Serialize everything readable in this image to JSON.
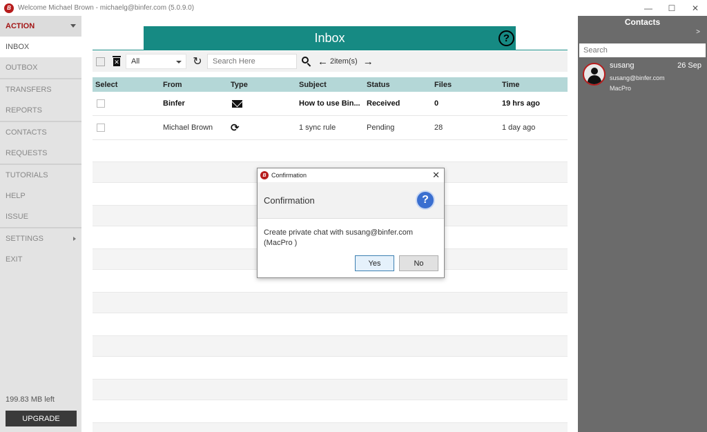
{
  "window": {
    "title": "Welcome  Michael Brown - michaelg@binfer.com (5.0.9.0)",
    "logo_text": "B",
    "controls": {
      "minimize": "—",
      "maximize": "☐",
      "close": "✕"
    }
  },
  "sidebar": {
    "action_label": "ACTION",
    "items": [
      {
        "label": "INBOX",
        "active": true
      },
      {
        "label": "OUTBOX"
      },
      {
        "label": "TRANSFERS"
      },
      {
        "label": "REPORTS"
      },
      {
        "label": "CONTACTS"
      },
      {
        "label": "REQUESTS"
      },
      {
        "label": "TUTORIALS"
      },
      {
        "label": "HELP"
      },
      {
        "label": "ISSUE"
      },
      {
        "label": "SETTINGS"
      },
      {
        "label": "EXIT"
      }
    ],
    "space_left": "199.83 MB left",
    "upgrade_label": "UPGRADE"
  },
  "inbox": {
    "title": "Inbox",
    "help_icon": "?",
    "toolbar": {
      "filter_value": "All",
      "search_placeholder": "Search Here",
      "item_count": "2item(s)"
    },
    "columns": [
      "Select",
      "From",
      "Type",
      "Subject",
      "Status",
      "Files",
      "Time"
    ],
    "rows": [
      {
        "from": "Binfer",
        "type_icon": "mail-icon",
        "subject": "How to use Bin...",
        "status": "Received",
        "files": "0",
        "time": "19 hrs ago",
        "unread": true
      },
      {
        "from": "Michael Brown",
        "type_icon": "sync-icon",
        "subject": "1 sync rule",
        "status": "Pending",
        "files": "28",
        "time": "1 day ago",
        "unread": false
      }
    ]
  },
  "contacts_panel": {
    "title": "Contacts",
    "expand": ">",
    "search_placeholder": "Search",
    "contacts": [
      {
        "name": "susang",
        "date": "26 Sep",
        "email": "susang@binfer.com",
        "device": "MacPro"
      }
    ]
  },
  "dialog": {
    "window_title": "Confirmation",
    "heading": "Confirmation",
    "question_icon": "?",
    "message": "Create private chat with susang@binfer.com (MacPro )",
    "yes_label": "Yes",
    "no_label": "No",
    "close_glyph": "✕"
  },
  "colors": {
    "accent_teal": "#168a83",
    "header_row": "#b4d7d7",
    "brand_red": "#b71c1c",
    "contacts_bg": "#6b6b6b"
  }
}
